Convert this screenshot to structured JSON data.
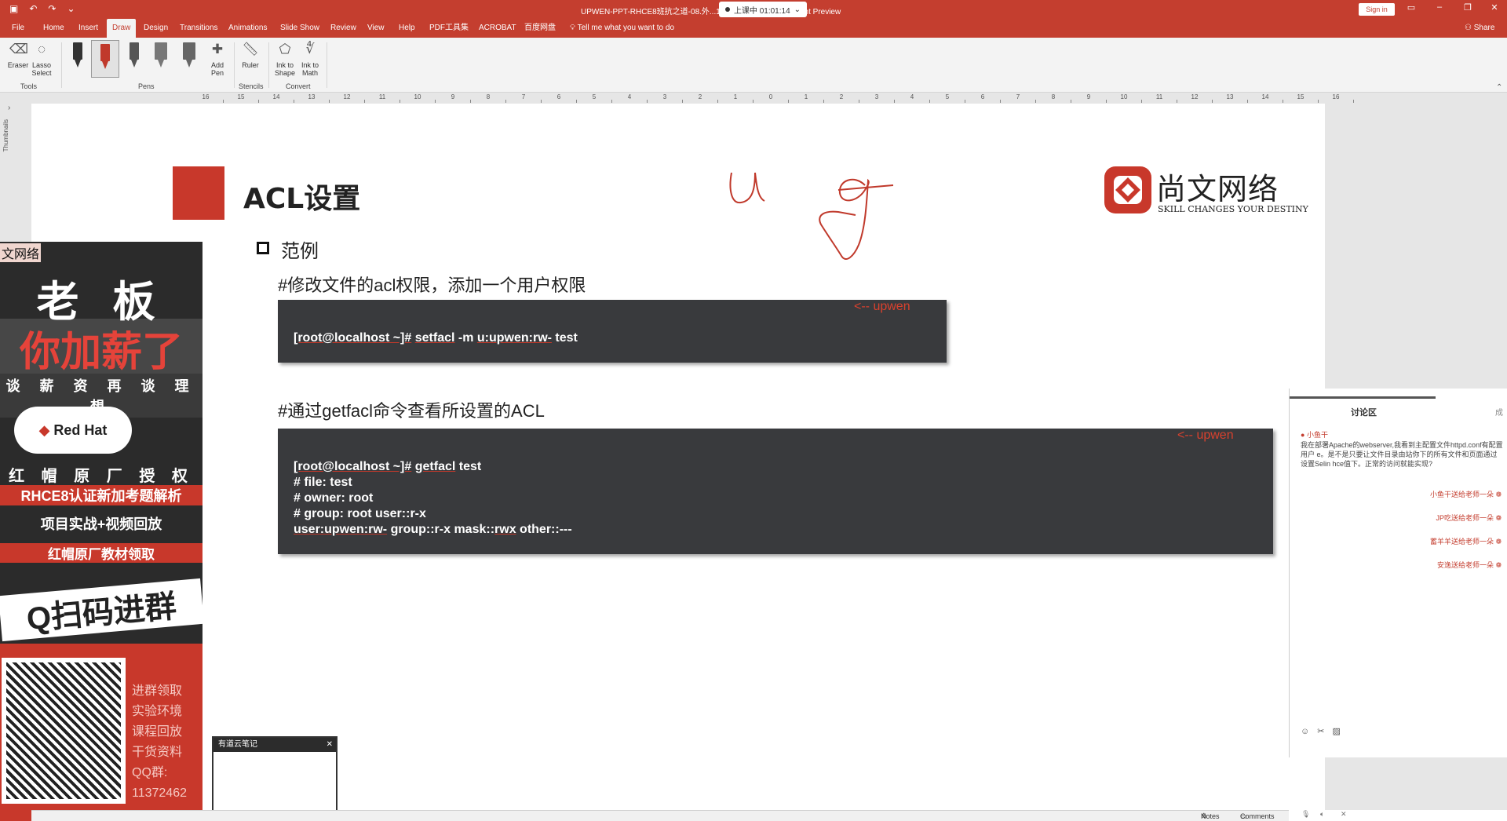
{
  "window": {
    "title": "UPWEN-PPT-RHCE8班抗之道-08.外...1210521.pptx - PowerPoint Preview",
    "recording": "上课中 01:01:14",
    "sign_in": "Sign in"
  },
  "tabs": [
    "File",
    "Home",
    "Insert",
    "Draw",
    "Design",
    "Transitions",
    "Animations",
    "Slide Show",
    "Review",
    "View",
    "Help",
    "PDF工具集",
    "ACROBAT",
    "百度网盘"
  ],
  "active_tab": "Draw",
  "tell_me": "Tell me what you want to do",
  "share": "Share",
  "ribbon": {
    "eraser": "Eraser",
    "lasso": "Lasso Select",
    "tools_group": "Tools",
    "pens_group": "Pens",
    "add_pen": "Add Pen",
    "ruler": "Ruler",
    "stencils_group": "Stencils",
    "ink_to_shape": "Ink to Shape",
    "ink_to_math": "Ink to Math",
    "convert_group": "Convert"
  },
  "ruler_numbers": [
    "16",
    "15",
    "14",
    "13",
    "12",
    "11",
    "10",
    "9",
    "8",
    "7",
    "6",
    "5",
    "4",
    "3",
    "2",
    "1",
    "0",
    "1",
    "2",
    "3",
    "4",
    "5",
    "6",
    "7",
    "8",
    "9",
    "10",
    "11",
    "12",
    "13",
    "14",
    "15",
    "16"
  ],
  "thumbnails_label": "Thumbnails",
  "slide": {
    "title": "ACL设置",
    "bullet": "范例",
    "heading1": "#修改文件的acl权限，添加一个用户权限",
    "code1": {
      "prompt": "[root@localhost ~]#",
      "cmd": "setfacl",
      "args1": " -m ",
      "arg_user": "u:upwen:rw-",
      "args2": " test",
      "annot": "<-- upwen"
    },
    "heading2": "#通过getfacl命令查看所设置的ACL",
    "code2": {
      "prompt": "[root@localhost ~]#",
      "cmd": "getfacl",
      "arg": " test",
      "line2": "# file: test",
      "line3": "# owner: root",
      "line4": "# group: root user::r-x",
      "line5_a": "user:upwen:rw-",
      "line5_b": " group::r-x mask::",
      "line5_c": "rwx",
      "line5_d": " other::---",
      "annot": "<-- upwen"
    },
    "logo_name": "尚文网络",
    "logo_tagline": "SKILL CHANGES YOUR DESTINY",
    "ink_color": "#c0392b"
  },
  "ad": {
    "corner": "文网络",
    "line1": "老 板",
    "line2": "你加薪了",
    "line3": "谈 薪 资 再 谈 理 想",
    "redhat": "Red Hat",
    "line5": "红 帽 原 厂 授 权",
    "line6": "RHCE8认证新加考题解析",
    "line7": "项目实战+视频回放",
    "line8": "红帽原厂教材领取",
    "line9": "Q扫码进群",
    "side": [
      "进群领取",
      "实验环境",
      "课程回放",
      "干货资料",
      "QQ群:",
      "11372462"
    ]
  },
  "notes_window": {
    "title": "有道云笔记"
  },
  "chat": {
    "header": "讨论区",
    "header2": "成",
    "user": "小鱼干",
    "message": "我在部署Apache的webserver,我看到主配置文件httpd.conf有配置用户 e。是不是只要让文件目录由站你下的所有文件和页面通过设置Selin hce值下。正常的访问就能实现?",
    "gifts": [
      "小鱼干送给老师一朵 ❁",
      "JP吃送给老师一朵 ❁",
      "蓄羊羊送给老师一朵 ❁",
      "安逸送给老师一朵 ❁"
    ]
  },
  "status": {
    "notes": "Notes",
    "comments": "Comments"
  }
}
